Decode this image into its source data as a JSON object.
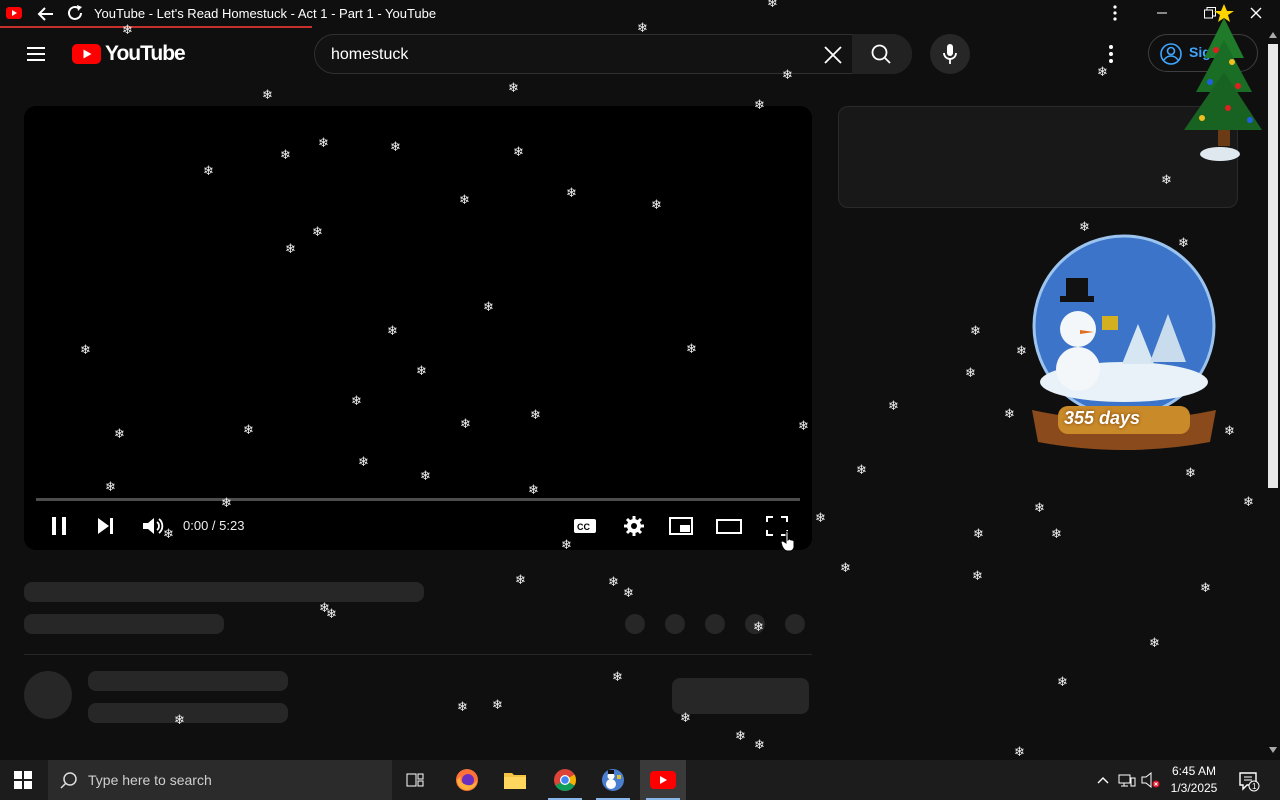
{
  "window": {
    "title": "YouTube - Let's Read Homestuck - Act 1 - Part 1 - YouTube"
  },
  "masthead": {
    "logo_text": "YouTube",
    "search_value": "homestuck",
    "signin_label": "Sig"
  },
  "player": {
    "time": "0:00 / 5:23",
    "progress": 0
  },
  "decoration": {
    "countdown": "355 days"
  },
  "taskbar": {
    "search_placeholder": "Type here to search",
    "time": "6:45 AM",
    "date": "1/3/2025",
    "notification_count": "1"
  },
  "colors": {
    "brand_red": "#ff0000",
    "background": "#0f0f0f",
    "skeleton": "#272727",
    "link_blue": "#3ea6ff"
  }
}
